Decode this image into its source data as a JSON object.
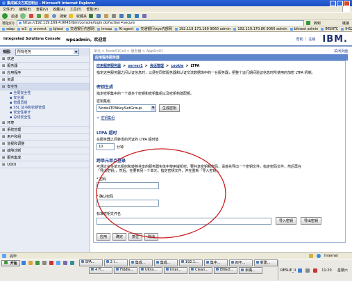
{
  "window": {
    "title": "集成解决方案控制台 - Microsoft Internet Explorer"
  },
  "menubar": [
    "文件(F)",
    "编辑(E)",
    "查看(V)",
    "收藏(A)",
    "工具(T)",
    "帮助(H)"
  ],
  "toolbar": {
    "back": "后退",
    "search": "搜索",
    "favorites": "收藏夹"
  },
  "address": {
    "label": "地址(D)",
    "url": "https://192.119.169.4:9043/ibm/console/login.do?action=secure",
    "go": "转到",
    "links": "链接"
  },
  "linksbar": [
    "sdap",
    "w3",
    "cnnmst",
    "bjtest",
    "交通银行内部网",
    "imsap",
    "AI-agent",
    "交通银行txyz内部网",
    "192.119.171.169 9060 admin",
    "192.119.170.80 9060 admin",
    "bitnest admin",
    "IMSNTC",
    "IHS2"
  ],
  "console_header": {
    "title": "Integrated Solutions Console",
    "welcome": "wpsadmin，欢迎您",
    "help": "帮助",
    "logout": "注销",
    "brand": "IBM."
  },
  "nav": {
    "view_label": "视图：",
    "view_value": "所有任务",
    "groups_top": [
      "欢迎",
      "服务器",
      "应用程序",
      "资源"
    ],
    "group_open": "安全性",
    "sub_items": [
      "全局安全性",
      "安全域",
      "管理员组",
      "SSL 证书和密钥管理",
      "安全性审计",
      "总线安全性"
    ],
    "groups_bottom": [
      "环境",
      "系统管理",
      "用户和组",
      "监视和调整",
      "故障诊断",
      "服务集成",
      "UDDI"
    ]
  },
  "content": {
    "breadcrumb": "单元 > Node01Cell > 服务器 > AppSrv01",
    "close_page": "关闭页面",
    "panel_title": "应用程序服务器",
    "path": [
      "应用程序服务器",
      "server1",
      "会话管理",
      "cookie"
    ],
    "path_last": "LTPA",
    "description": "指定这些服务器之间认证信息时，以便在同样服务器和认证交流数据库中的一台服务器，把整个运行期间验证信息时所使用的加密 LTPA 机制。",
    "keygen": {
      "title": "密钥生成",
      "desc": "指定密钥集中的一个或多个密钥和密钥集组以及密钥构建配额。",
      "set_label": "密钥集组",
      "set_value": "NodeLTPAKeySetGroup",
      "generate_button": "生成密钥",
      "set_link": "密钥集组"
    },
    "timeout": {
      "title": "LTPA 超时",
      "desc": "在服务器之间转发的凭证的 LTPA 超时值",
      "value": "10",
      "unit": "分钟"
    },
    "sso": {
      "title": "跨单元单点登录",
      "desc": "可通过在多单元组织和转移共享的服务器实体中使用域机密，要共享密钥和密码，请首先导出一个密钥文件，指定密码文件，然后再在「导出密钥」，然后，在要到另一个单元，指定密钥文件，并在重新「导入密钥」。",
      "password_label": "* 密码",
      "confirm_label": "* 确认密码",
      "file_label": "标准密钥文件名",
      "import_button": "导入密钥",
      "export_button": "导出密钥"
    },
    "buttons": [
      "应用",
      "确定",
      "复位",
      "取消"
    ]
  },
  "status": {
    "done": "完毕",
    "zone": "Internet"
  },
  "taskbar": {
    "start": "开始",
    "row1": [
      "SPA...",
      "2 I...",
      "集成...",
      "集成...",
      "192.1...",
      "集中...",
      "四不...",
      "新建..."
    ],
    "row2": [
      "4 Fi...",
      "Fiddle...",
      "Ultra...",
      "Inter...",
      "Clean...",
      "ENGD...",
      "未确..."
    ],
    "tray_input": "RESUP_II",
    "time": "11:20",
    "weekday": "星期六"
  },
  "annotation": {
    "color": "#cc1d1d"
  },
  "colors": {
    "titlebar": "#1b4fc3",
    "nav_bg": "#e8ecf5",
    "panel_head": "#5e86cc",
    "taskbar": "#eae9e3"
  }
}
